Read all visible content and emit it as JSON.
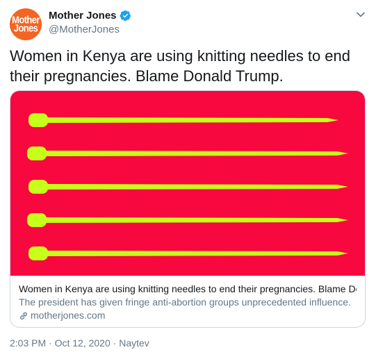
{
  "account": {
    "display_name": "Mother Jones",
    "handle": "@MotherJones",
    "avatar_text_line1": "Mother",
    "avatar_text_line2": "Jones",
    "verified": true
  },
  "tweet": {
    "text": "Women in Kenya are using knitting needles to end their pregnancies. Blame Donald Trump.",
    "timestamp": "2:03 PM · Oct 12, 2020",
    "separator": " · ",
    "source": "Naytev"
  },
  "card": {
    "title": "Women in Kenya are using knitting needles to end their pregnancies. Blame Don...",
    "description": "The president has given fringe anti-abortion groups unprecedented influence.",
    "domain": "motherjones.com",
    "image_background": "#f7083f",
    "needle_color": "#c6ff1a",
    "needle_count": 5
  },
  "icons": {
    "verified": "verified-badge-icon",
    "caret": "chevron-down-icon",
    "link": "link-icon"
  },
  "colors": {
    "brand_orange": "#f26522",
    "verified_blue": "#1da1f2",
    "secondary_text": "#657786"
  }
}
